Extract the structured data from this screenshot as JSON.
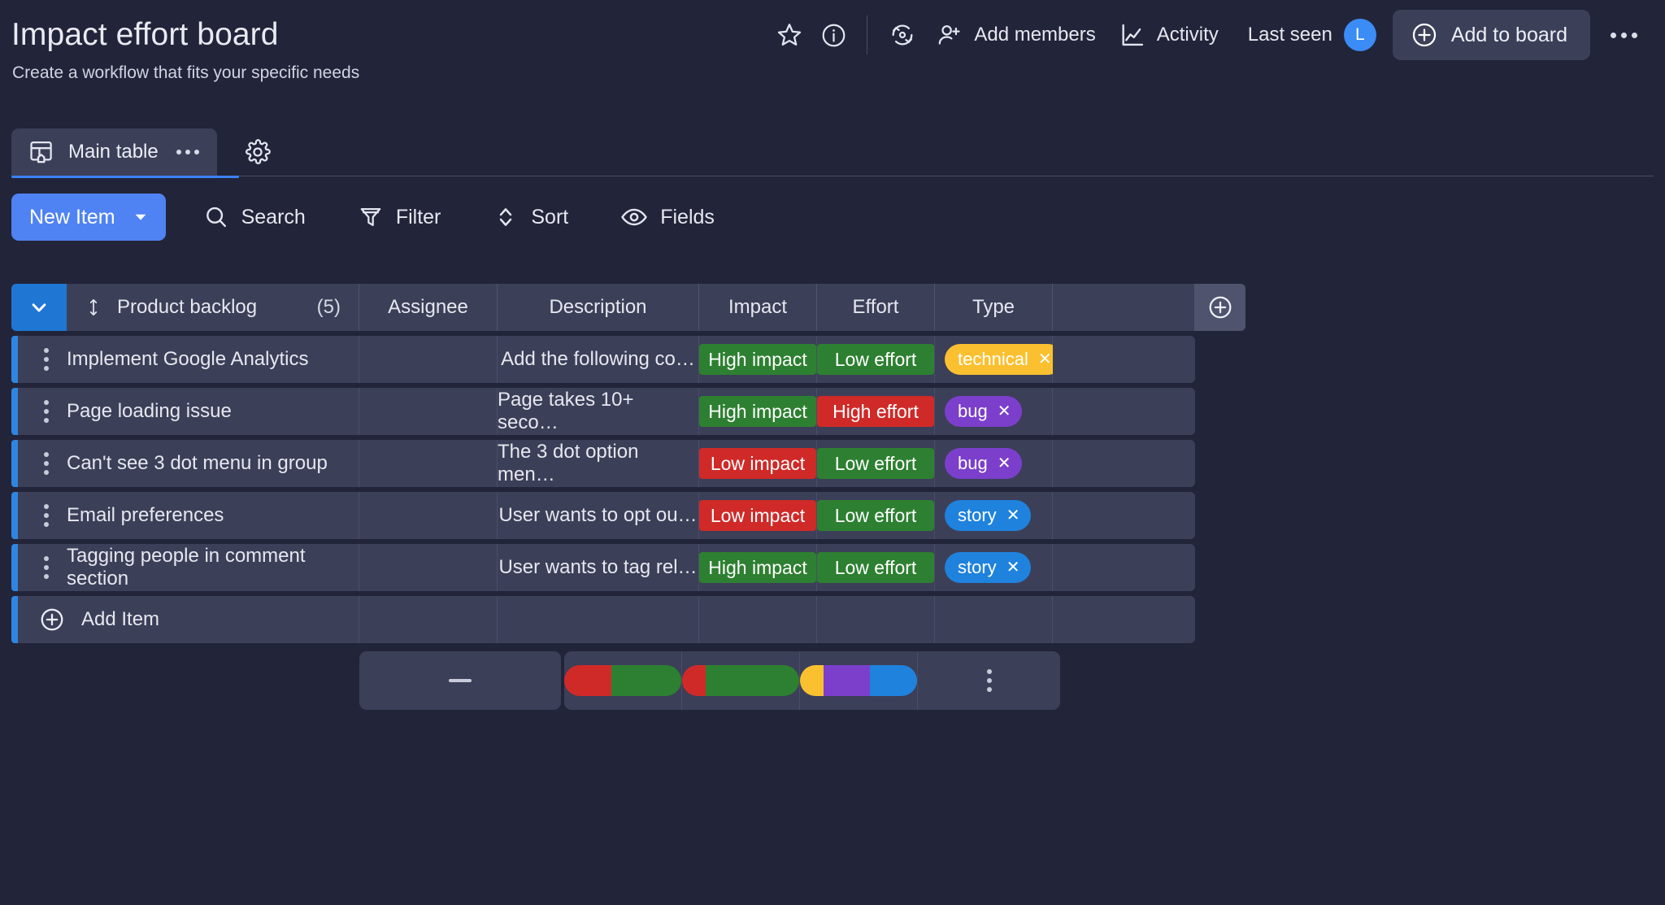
{
  "header": {
    "title": "Impact effort board",
    "subtitle": "Create a workflow that fits your specific needs",
    "actions": {
      "favorite_icon": "star-icon",
      "info_icon": "info-circle-icon",
      "activity_log_icon": "refresh-sync-icon",
      "add_members_label": "Add members",
      "activity_label": "Activity",
      "last_seen_label": "Last seen",
      "last_seen_avatar_initial": "L",
      "add_to_board_label": "Add to board",
      "more_options_icon": "ellipsis-horizontal-icon"
    }
  },
  "tabs": {
    "items": [
      {
        "label": "Main table",
        "icon": "table-home-icon",
        "active": true
      }
    ],
    "settings_icon": "gear-icon"
  },
  "toolbar": {
    "new_item_label": "New Item",
    "new_item_caret_icon": "chevron-down-icon",
    "buttons": [
      {
        "label": "Search",
        "icon": "search-icon"
      },
      {
        "label": "Filter",
        "icon": "filter-funnel-icon"
      },
      {
        "label": "Sort",
        "icon": "sort-updown-icon"
      },
      {
        "label": "Fields",
        "icon": "eye-icon"
      }
    ]
  },
  "table": {
    "group": {
      "name": "Product backlog",
      "count": "(5)",
      "collapse_icon": "chevron-down-icon",
      "drag_icon": "drag-vertical-icon"
    },
    "columns": [
      {
        "label": "Assignee"
      },
      {
        "label": "Description"
      },
      {
        "label": "Impact"
      },
      {
        "label": "Effort"
      },
      {
        "label": "Type"
      }
    ],
    "add_column_icon": "plus-circle-icon",
    "rows": [
      {
        "name": "Implement Google Analytics",
        "assignee": "",
        "description": "Add the following co…",
        "impact": {
          "label": "High impact",
          "color": "green"
        },
        "effort": {
          "label": "Low effort",
          "color": "green"
        },
        "type": {
          "label": "technical",
          "color": "yellow"
        }
      },
      {
        "name": "Page loading issue",
        "assignee": "",
        "description": "Page takes 10+ seco…",
        "impact": {
          "label": "High impact",
          "color": "green"
        },
        "effort": {
          "label": "High effort",
          "color": "red"
        },
        "type": {
          "label": "bug",
          "color": "purple"
        }
      },
      {
        "name": "Can't see 3 dot menu in group",
        "assignee": "",
        "description": "The 3 dot option men…",
        "impact": {
          "label": "Low impact",
          "color": "red"
        },
        "effort": {
          "label": "Low effort",
          "color": "green"
        },
        "type": {
          "label": "bug",
          "color": "purple"
        }
      },
      {
        "name": "Email preferences",
        "assignee": "",
        "description": "User wants to opt ou…",
        "impact": {
          "label": "Low impact",
          "color": "red"
        },
        "effort": {
          "label": "Low effort",
          "color": "green"
        },
        "type": {
          "label": "story",
          "color": "blue"
        }
      },
      {
        "name": "Tagging people in comment section",
        "assignee": "",
        "description": "User wants to tag rel…",
        "impact": {
          "label": "High impact",
          "color": "green"
        },
        "effort": {
          "label": "Low effort",
          "color": "green"
        },
        "type": {
          "label": "story",
          "color": "blue"
        }
      }
    ],
    "add_item_label": "Add Item",
    "add_item_icon": "plus-circle-icon",
    "summary": {
      "assignee_value": "—",
      "impact_segments": [
        {
          "color": "#cf2a28",
          "pct": 40
        },
        {
          "color": "#2d8031",
          "pct": 60
        }
      ],
      "effort_segments": [
        {
          "color": "#cf2a28",
          "pct": 20
        },
        {
          "color": "#2d8031",
          "pct": 80
        }
      ],
      "type_segments": [
        {
          "color": "#fbc02f",
          "pct": 20
        },
        {
          "color": "#7b3fcc",
          "pct": 40
        },
        {
          "color": "#1f82dd",
          "pct": 40
        }
      ],
      "menu_icon": "ellipsis-vertical-icon"
    }
  },
  "colors": {
    "background": "#22243a",
    "surface": "#3c3f58",
    "accent_blue": "#3b82f6",
    "row_accent": "#2f86e0",
    "green": "#2d8031",
    "red": "#cf2a28",
    "yellow": "#fbc02f",
    "purple": "#7b3fcc",
    "blue": "#1f82dd"
  }
}
